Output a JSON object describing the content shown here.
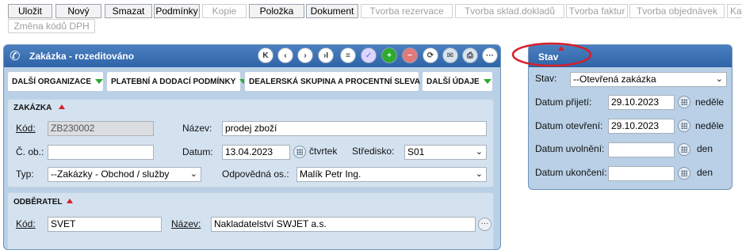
{
  "toolbar": {
    "buttons": [
      {
        "label": "Uložit",
        "enabled": true
      },
      {
        "label": "Nový",
        "enabled": true
      },
      {
        "label": "Smazat",
        "enabled": true
      },
      {
        "label": "Podmínky",
        "enabled": true
      },
      {
        "label": "Kopie",
        "enabled": false
      },
      {
        "label": "Položka",
        "enabled": true
      },
      {
        "label": "Dokument",
        "enabled": true
      },
      {
        "label": "Tvorba rezervace",
        "enabled": false
      },
      {
        "label": "Tvorba sklad.dokladů",
        "enabled": false
      },
      {
        "label": "Tvorba faktur",
        "enabled": false
      },
      {
        "label": "Tvorba objednávek",
        "enabled": false
      },
      {
        "label": "Ka",
        "enabled": false
      },
      {
        "label": "Změna kódů DPH",
        "enabled": false
      }
    ]
  },
  "main_panel": {
    "title": "Zakázka - rozeditováno",
    "nav_icons": [
      "first-icon",
      "prev-icon",
      "next-icon",
      "last-icon",
      "list-icon",
      "check-icon",
      "add-icon",
      "remove-icon",
      "refresh-icon",
      "mail-icon",
      "print-icon",
      "more-icon"
    ],
    "nav_glyphs": [
      "K",
      "‹",
      "›",
      "›I",
      "≡",
      "✓",
      "+",
      "−",
      "⟳",
      "✉",
      "⎙",
      "···"
    ],
    "tabs": [
      {
        "label": "DALŠÍ ORGANIZACE"
      },
      {
        "label": "PLATEBNÍ A DODACÍ PODMÍNKY"
      },
      {
        "label": "DEALERSKÁ SKUPINA A PROCENTNÍ SLEVA"
      },
      {
        "label": "DALŠÍ ÚDAJE"
      }
    ],
    "zakazka": {
      "title": "ZAKÁZKA",
      "kod_label": "Kód:",
      "kod_value": "ZB230002",
      "nazev_label": "Název:",
      "nazev_value": "prodej zboží",
      "cob_label": "Č. ob.:",
      "cob_value": "",
      "datum_label": "Datum:",
      "datum_value": "13.04.2023",
      "datum_day": "čtvrtek",
      "stredisko_label": "Středisko:",
      "stredisko_value": "S01",
      "typ_label": "Typ:",
      "typ_value": "--Zakázky - Obchod / služby",
      "odpovedna_label": "Odpovědná os.:",
      "odpovedna_value": "Malík Petr Ing."
    },
    "odberatel": {
      "title": "ODBĚRATEL",
      "kod_label": "Kód:",
      "kod_value": "SVET",
      "nazev_label": "Název:",
      "nazev_value": "Nakladatelství SWJET a.s."
    }
  },
  "stav_panel": {
    "title": "Stav",
    "stav_label": "Stav:",
    "stav_value": "--Otevřená zakázka",
    "prijeti_label": "Datum přijetí:",
    "prijeti_value": "29.10.2023",
    "prijeti_day": "neděle",
    "otevreni_label": "Datum otevření:",
    "otevreni_value": "29.10.2023",
    "otevreni_day": "neděle",
    "uvolneni_label": "Datum uvolnění:",
    "uvolneni_value": "",
    "uvolneni_day": "den",
    "ukonceni_label": "Datum ukončení:",
    "ukonceni_value": "",
    "ukonceni_day": "den"
  },
  "colors": {
    "header_blue": "#2f64a8",
    "panel_bg": "#b9d0e6",
    "highlight_red": "#d6202a",
    "tab_arrow_green": "#2eaa2e"
  }
}
